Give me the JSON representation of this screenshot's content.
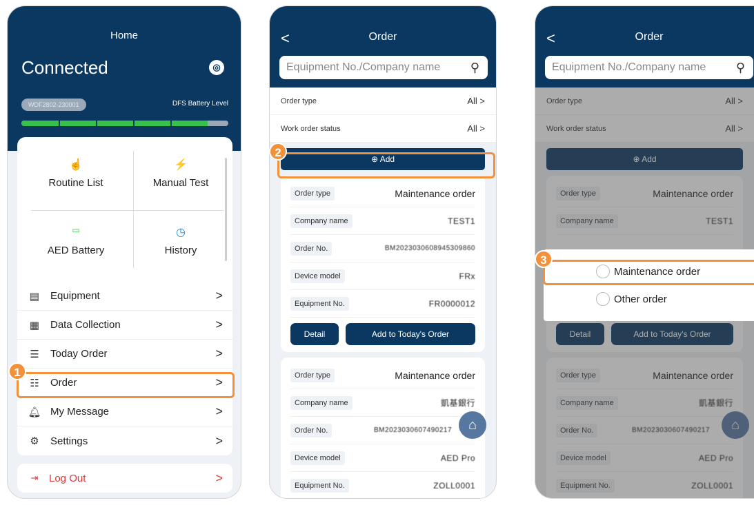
{
  "phone1": {
    "title": "Home",
    "status": "Connected",
    "device_id": "WDF2802-230001",
    "battery_label": "DFS Battery Level",
    "battery_fraction": 0.9,
    "grid": [
      "Routine List",
      "Manual Test",
      "AED Battery",
      "History"
    ],
    "menu": [
      "Equipment",
      "Data Collection",
      "Today Order",
      "Order",
      "My Message",
      "Settings"
    ],
    "logout": "Log Out",
    "chevron": ">"
  },
  "order": {
    "title": "Order",
    "back": "<",
    "search_placeholder": "Equipment No./Company name",
    "filters": [
      {
        "label": "Order type",
        "value": "All >"
      },
      {
        "label": "Work order status",
        "value": "All >"
      }
    ],
    "add_label": "Add",
    "card1": [
      {
        "k": "Order type",
        "v": "Maintenance order"
      },
      {
        "k": "Company name",
        "v": "TEST1"
      },
      {
        "k": "Order No.",
        "v": "BM2023030608945309860"
      },
      {
        "k": "Device model",
        "v": "FRx"
      },
      {
        "k": "Equipment No.",
        "v": "FR0000012"
      }
    ],
    "detail_label": "Detail",
    "add_today_label": "Add to Today's Order",
    "card2": [
      {
        "k": "Order type",
        "v": "Maintenance order"
      },
      {
        "k": "Company name",
        "v": "凱基銀行"
      },
      {
        "k": "Order No.",
        "v": "BM2023030607490217"
      },
      {
        "k": "Device model",
        "v": "AED Pro"
      },
      {
        "k": "Equipment No.",
        "v": "ZOLL0001"
      }
    ]
  },
  "dialog": {
    "options": [
      "Maintenance order",
      "Other order"
    ]
  },
  "badges": [
    "1",
    "2",
    "3"
  ],
  "colors": {
    "navy": "#0b3861",
    "highlight": "#f2913a",
    "logout": "#d63a3a",
    "battery": "#38c24b"
  }
}
